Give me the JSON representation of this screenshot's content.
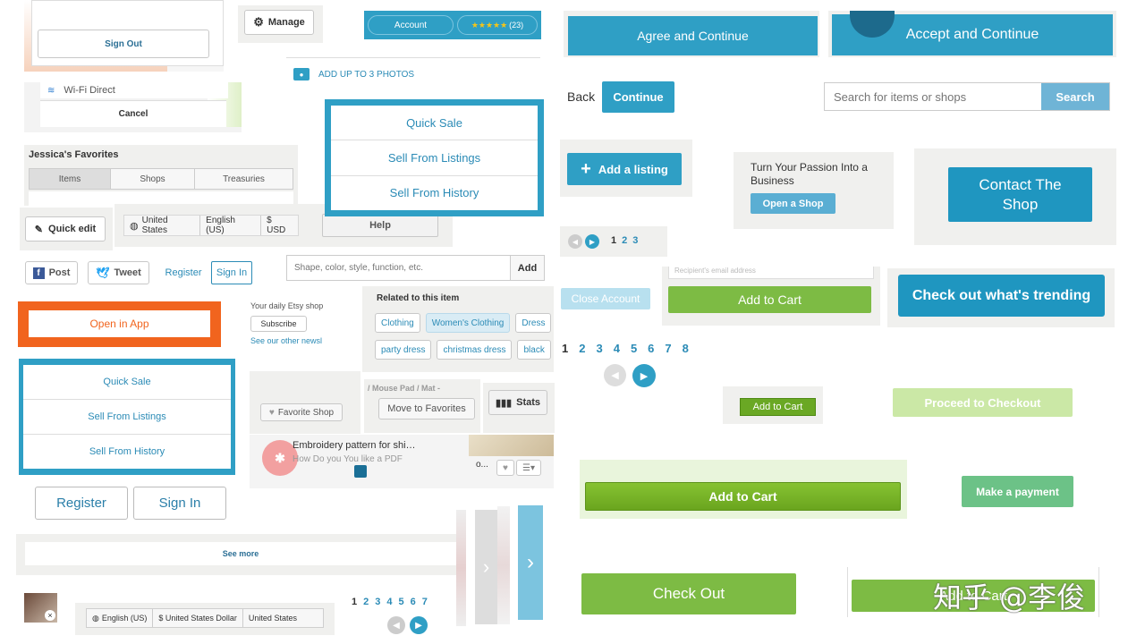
{
  "sign_out": "Sign Out",
  "manage": "Manage",
  "account_bar": {
    "account": "Account",
    "stars": "★★★★★",
    "count": "(23)"
  },
  "add_photos": "ADD UP TO 3 PHOTOS",
  "wifi": "Wi-Fi Direct",
  "cancel": "Cancel",
  "favorites": {
    "title": "Jessica's Favorites",
    "tabs": [
      "Items",
      "Shops",
      "Treasuries"
    ]
  },
  "sale_menu_top": [
    "Quick Sale",
    "Sell From Listings",
    "Sell From History"
  ],
  "quick_edit": "Quick edit",
  "locale_bar": {
    "country": "United States",
    "language": "English (US)",
    "currency": "$ USD"
  },
  "help": "Help",
  "social": {
    "post": "Post",
    "tweet": "Tweet",
    "register": "Register",
    "sign_in": "Sign In"
  },
  "search_shape": {
    "placeholder": "Shape, color, style, function, etc.",
    "add": "Add"
  },
  "open_in_app": "Open in App",
  "daily": {
    "text": "Your daily Etsy shop",
    "subscribe": "Subscribe",
    "other": "See our other newsl"
  },
  "related": {
    "title": "Related to this item",
    "tags_row1": [
      "Clothing",
      "Women's Clothing",
      "Dress"
    ],
    "tags_row2": [
      "party dress",
      "christmas dress",
      "black"
    ]
  },
  "sale_menu_bottom": [
    "Quick Sale",
    "Sell From Listings",
    "Sell From History"
  ],
  "favorite_shop": "Favorite Shop",
  "mouse_pad": "/ Mouse Pad / Mat -",
  "move_to_favorites": "Move to Favorites",
  "stats": "Stats",
  "embroidery": "Embroidery pattern for shi…",
  "embroidery2": "How Do you You like a PDF",
  "o_text": "o...",
  "register_lg": "Register",
  "sign_in_lg": "Sign In",
  "see_more": "See more",
  "bottom_locale": {
    "language": "English (US)",
    "currency": "$ United States Dollar",
    "country": "United States"
  },
  "pager_bottom": [
    "1",
    "2",
    "3",
    "4",
    "5",
    "6",
    "7"
  ],
  "agree": "Agree and Continue",
  "accept": "Accept and Continue",
  "back": "Back",
  "continue": "Continue",
  "search_items": {
    "placeholder": "Search for items or shops",
    "button": "Search"
  },
  "add_listing": "Add a listing",
  "passion": {
    "text": "Turn Your Passion Into a Business",
    "button": "Open a Shop"
  },
  "contact_shop": "Contact The Shop",
  "pager_small": [
    "1",
    "2",
    "3"
  ],
  "recipient": "Recipient's email address",
  "close_account": "Close Account",
  "add_to_cart_1": "Add to Cart",
  "check_trending": "Check out what's trending",
  "pager_mid": [
    "1",
    "2",
    "3",
    "4",
    "5",
    "6",
    "7",
    "8"
  ],
  "add_to_cart_small": "Add to Cart",
  "proceed": "Proceed to Checkout",
  "add_to_cart_big": "Add to Cart",
  "make_payment": "Make a payment",
  "check_out": "Check Out",
  "add_to_cart_last": "Add to Cart",
  "watermark": "知乎 @李俊",
  "colors": {
    "etsy_blue": "#2f9fc5",
    "etsy_orange": "#f1641e",
    "etsy_green": "#7dbb44"
  }
}
